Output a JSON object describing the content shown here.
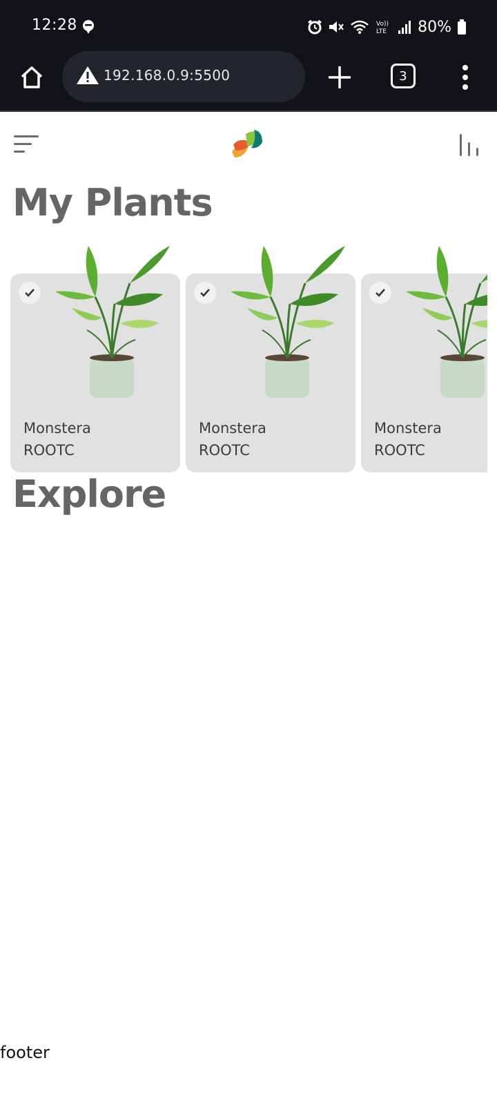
{
  "status_bar": {
    "time": "12:28",
    "battery": "80%"
  },
  "browser": {
    "url": "192.168.0.9:5500",
    "tab_count": "3"
  },
  "page": {
    "my_plants_title": "My Plants",
    "explore_title": "Explore",
    "footer": "footer"
  },
  "plants": [
    {
      "name": "Monstera",
      "brand": "ROOTC",
      "selected": true
    },
    {
      "name": "Monstera",
      "brand": "ROOTC",
      "selected": true
    },
    {
      "name": "Monstera",
      "brand": "ROOTC",
      "selected": true
    }
  ],
  "colors": {
    "status_bg": "#121316",
    "url_bg": "#22252c",
    "card_bg": "#e1e1e1",
    "title_text": "#656565"
  },
  "icons": {
    "status_left": "message-icon",
    "status_right": [
      "alarm-icon",
      "mute-icon",
      "wifi-icon",
      "volte-icon",
      "signal-icon",
      "battery-icon"
    ],
    "browser": [
      "home-icon",
      "warning-icon",
      "plus-icon",
      "tabs-icon",
      "more-icon"
    ],
    "header": [
      "menu-icon",
      "logo",
      "stats-icon"
    ]
  }
}
